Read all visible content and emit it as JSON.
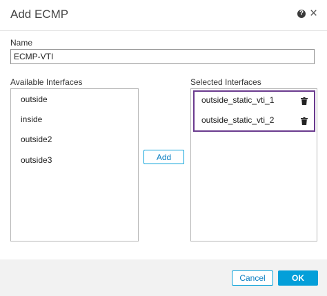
{
  "dialog": {
    "title": "Add ECMP",
    "help_icon_glyph": "?",
    "close_glyph": "×"
  },
  "name_field": {
    "label": "Name",
    "value": "ECMP-VTI"
  },
  "available": {
    "label": "Available Interfaces",
    "items": [
      "outside",
      "inside",
      "outside2",
      "outside3"
    ]
  },
  "selected": {
    "label": "Selected Interfaces",
    "items": [
      "outside_static_vti_1",
      "outside_static_vti_2"
    ],
    "highlight_color": "#6a3a8e"
  },
  "buttons": {
    "add": "Add",
    "cancel": "Cancel",
    "ok": "OK"
  },
  "colors": {
    "accent": "#049fd9",
    "footer_bg": "#f2f2f2"
  },
  "icons": {
    "help": "help-icon",
    "close": "close-icon",
    "delete": "trash-icon"
  }
}
